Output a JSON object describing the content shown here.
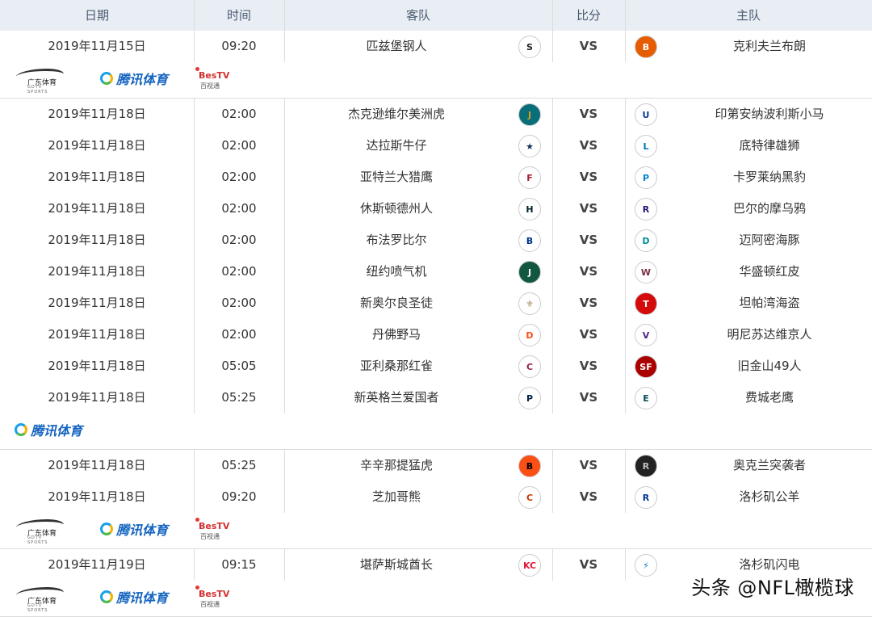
{
  "headers": {
    "date": "日期",
    "time": "时间",
    "away": "客队",
    "score": "比分",
    "home": "主队"
  },
  "broadcast": {
    "gd": "广东体育",
    "gd_sub": "GDTV SPORTS",
    "tencent": "腾讯体育",
    "bestv": "BesTV",
    "bestv_sub": "百视通"
  },
  "rows": [
    {
      "date": "2019年11月15日",
      "time": "09:20",
      "away": "匹兹堡钢人",
      "away_icon": "steelers-icon",
      "vs": "VS",
      "home_icon": "browns-icon",
      "home": "克利夫兰布朗"
    },
    {
      "date": "2019年11月18日",
      "time": "02:00",
      "away": "杰克逊维尔美洲虎",
      "away_icon": "jaguars-icon",
      "vs": "VS",
      "home_icon": "colts-icon",
      "home": "印第安纳波利斯小马"
    },
    {
      "date": "2019年11月18日",
      "time": "02:00",
      "away": "达拉斯牛仔",
      "away_icon": "cowboys-icon",
      "vs": "VS",
      "home_icon": "lions-icon",
      "home": "底特律雄狮"
    },
    {
      "date": "2019年11月18日",
      "time": "02:00",
      "away": "亚特兰大猎鹰",
      "away_icon": "falcons-icon",
      "vs": "VS",
      "home_icon": "panthers-icon",
      "home": "卡罗莱纳黑豹"
    },
    {
      "date": "2019年11月18日",
      "time": "02:00",
      "away": "休斯顿德州人",
      "away_icon": "texans-icon",
      "vs": "VS",
      "home_icon": "ravens-icon",
      "home": "巴尔的摩乌鸦"
    },
    {
      "date": "2019年11月18日",
      "time": "02:00",
      "away": "布法罗比尔",
      "away_icon": "bills-icon",
      "vs": "VS",
      "home_icon": "dolphins-icon",
      "home": "迈阿密海豚"
    },
    {
      "date": "2019年11月18日",
      "time": "02:00",
      "away": "纽约喷气机",
      "away_icon": "jets-icon",
      "vs": "VS",
      "home_icon": "redskins-icon",
      "home": "华盛顿红皮"
    },
    {
      "date": "2019年11月18日",
      "time": "02:00",
      "away": "新奥尔良圣徒",
      "away_icon": "saints-icon",
      "vs": "VS",
      "home_icon": "buccaneers-icon",
      "home": "坦帕湾海盗"
    },
    {
      "date": "2019年11月18日",
      "time": "02:00",
      "away": "丹佛野马",
      "away_icon": "broncos-icon",
      "vs": "VS",
      "home_icon": "vikings-icon",
      "home": "明尼苏达维京人"
    },
    {
      "date": "2019年11月18日",
      "time": "05:05",
      "away": "亚利桑那红雀",
      "away_icon": "cardinals-icon",
      "vs": "VS",
      "home_icon": "49ers-icon",
      "home": "旧金山49人"
    },
    {
      "date": "2019年11月18日",
      "time": "05:25",
      "away": "新英格兰爱国者",
      "away_icon": "patriots-icon",
      "vs": "VS",
      "home_icon": "eagles-icon",
      "home": "费城老鹰"
    },
    {
      "date": "2019年11月18日",
      "time": "05:25",
      "away": "辛辛那提猛虎",
      "away_icon": "bengals-icon",
      "vs": "VS",
      "home_icon": "raiders-icon",
      "home": "奥克兰突袭者"
    },
    {
      "date": "2019年11月18日",
      "time": "09:20",
      "away": "芝加哥熊",
      "away_icon": "bears-icon",
      "vs": "VS",
      "home_icon": "rams-icon",
      "home": "洛杉矶公羊"
    },
    {
      "date": "2019年11月19日",
      "time": "09:15",
      "away": "堪萨斯城酋长",
      "away_icon": "chiefs-icon",
      "vs": "VS",
      "home_icon": "chargers-icon",
      "home": "洛杉矶闪电"
    }
  ],
  "colors": {
    "header_bg": "#e9eef5",
    "border": "#dcdcdc",
    "tencent_blue": "#1565c0",
    "bestv_red": "#d32f2f"
  },
  "watermark": "头条 @NFL橄榄球"
}
